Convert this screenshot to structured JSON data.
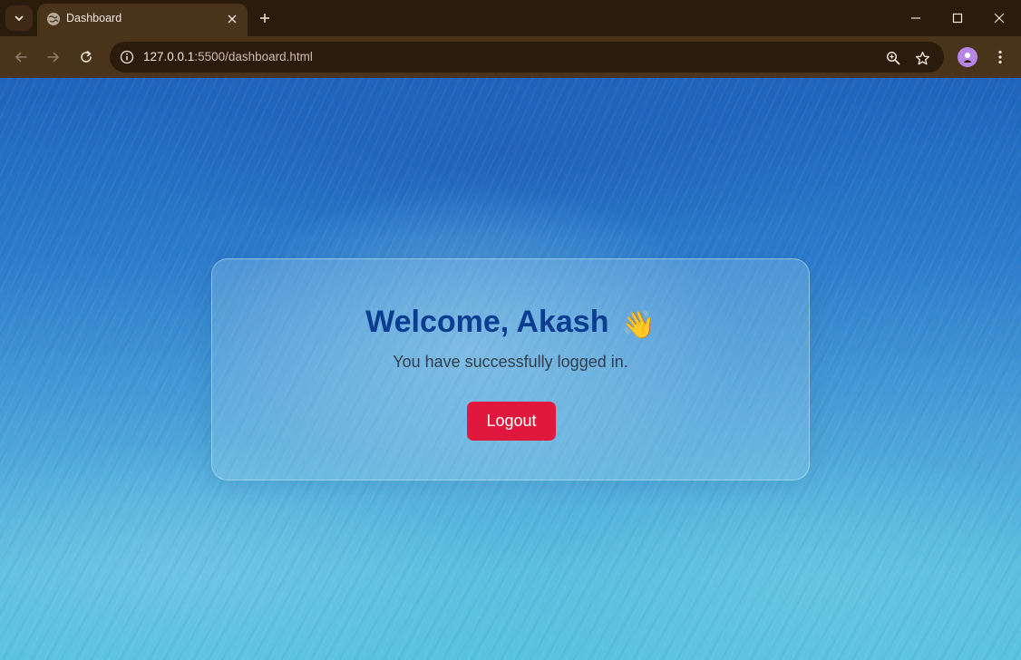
{
  "browser": {
    "tab": {
      "title": "Dashboard"
    },
    "address_bar": {
      "host": "127.0.0.1",
      "path": ":5500/dashboard.html"
    }
  },
  "page": {
    "welcome": "Welcome, Akash",
    "wave_emoji": "👋",
    "subtitle": "You have successfully logged in.",
    "logout_label": "Logout"
  },
  "colors": {
    "heading": "#0a3d91",
    "logout_button": "#e0183d",
    "browser_chrome": "#4a331b"
  },
  "icons": {
    "tab_search": "chevron-down-icon",
    "favicon": "globe-icon",
    "tab_close": "close-icon",
    "new_tab": "plus-icon",
    "minimize": "minimize-icon",
    "maximize": "maximize-icon",
    "close_window": "close-icon",
    "back": "back-arrow-icon",
    "forward": "forward-arrow-icon",
    "reload": "reload-icon",
    "site_info": "info-icon",
    "zoom": "zoom-icon",
    "bookmark": "star-icon",
    "profile": "avatar",
    "menu": "kebab-menu-icon"
  }
}
